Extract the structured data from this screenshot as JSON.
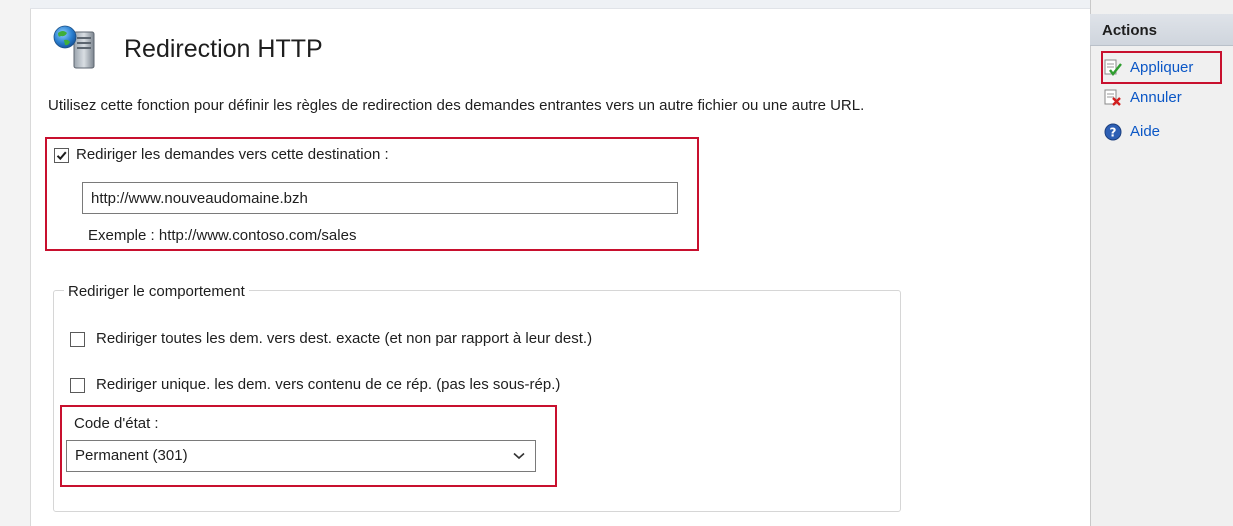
{
  "page": {
    "title": "Redirection HTTP",
    "description": "Utilisez cette fonction pour définir les règles de redirection des demandes entrantes vers un autre fichier ou une autre URL."
  },
  "redirect": {
    "checkbox_label": "Rediriger les demandes vers cette destination :",
    "checked": true,
    "url_value": "http://www.nouveaudomaine.bzh",
    "example": "Exemple : http://www.contoso.com/sales"
  },
  "behavior": {
    "group_label": "Rediriger le comportement",
    "option1_label": "Rediriger toutes les dem. vers dest. exacte (et non par rapport à leur dest.)",
    "option1_checked": false,
    "option2_label": "Rediriger unique. les dem. vers contenu de ce rép. (pas les sous-rép.)",
    "option2_checked": false,
    "status_label": "Code d'état :",
    "status_value": "Permanent (301)"
  },
  "actions": {
    "title": "Actions",
    "items": [
      {
        "label": "Appliquer",
        "icon": "apply-icon"
      },
      {
        "label": "Annuler",
        "icon": "cancel-icon"
      },
      {
        "label": "Aide",
        "icon": "help-icon"
      }
    ]
  },
  "colors": {
    "highlight": "#c8102e",
    "link": "#0b57c6"
  }
}
